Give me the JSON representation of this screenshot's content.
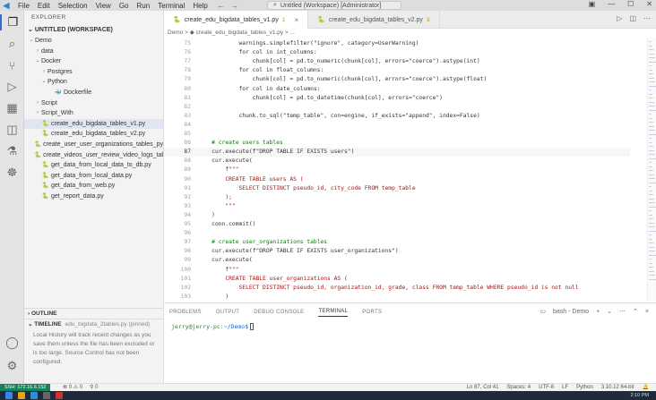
{
  "titlebar": {
    "logo": "◀",
    "menu": [
      "File",
      "Edit",
      "Selection",
      "View",
      "Go",
      "Run",
      "Terminal",
      "Help"
    ],
    "search": "Untitled (Workspace) [Administrator]"
  },
  "activity": [
    {
      "icon": "files-icon",
      "glyph": "❐"
    },
    {
      "icon": "search-icon",
      "glyph": "⌕"
    },
    {
      "icon": "source-control-icon",
      "glyph": "⑂"
    },
    {
      "icon": "run-debug-icon",
      "glyph": "▷"
    },
    {
      "icon": "extensions-icon",
      "glyph": "▦"
    },
    {
      "icon": "remote-explorer-icon",
      "glyph": "◫"
    },
    {
      "icon": "testing-icon",
      "glyph": "⚗"
    },
    {
      "icon": "docker-icon",
      "glyph": "☸"
    }
  ],
  "sidebar": {
    "header": "EXPLORER",
    "workspace": "UNTITLED (WORKSPACE)",
    "items": [
      {
        "label": "Demo",
        "chev": "⌄",
        "icon": "",
        "indent": 0
      },
      {
        "label": "data",
        "chev": "›",
        "icon": "",
        "indent": 1
      },
      {
        "label": "Docker",
        "chev": "⌄",
        "icon": "",
        "indent": 1
      },
      {
        "label": "Postgres",
        "chev": "›",
        "icon": "",
        "indent": 2
      },
      {
        "label": "Python",
        "chev": "⌄",
        "icon": "",
        "indent": 2
      },
      {
        "label": "Dockerfile",
        "chev": "",
        "icon": "🐳",
        "indent": 3
      },
      {
        "label": "Script",
        "chev": "›",
        "icon": "",
        "indent": 1
      },
      {
        "label": "Script_With",
        "chev": "›",
        "icon": "",
        "indent": 1
      },
      {
        "label": "create_edu_bigdata_tables_v1.py",
        "chev": "",
        "icon": "🐍",
        "indent": 1,
        "selected": true
      },
      {
        "label": "create_edu_bigdata_tables_v2.py",
        "chev": "",
        "icon": "🐍",
        "indent": 1
      },
      {
        "label": "create_user_user_organizations_tables_py...",
        "chev": "",
        "icon": "🐍",
        "indent": 1
      },
      {
        "label": "create_videos_user_review_video_logs_tab...",
        "chev": "",
        "icon": "🐍",
        "indent": 1
      },
      {
        "label": "get_data_from_local_data_to_db.py",
        "chev": "",
        "icon": "🐍",
        "indent": 1
      },
      {
        "label": "get_data_from_local_data.py",
        "chev": "",
        "icon": "🐍",
        "indent": 1
      },
      {
        "label": "get_data_from_web.py",
        "chev": "",
        "icon": "🐍",
        "indent": 1
      },
      {
        "label": "get_report_data.py",
        "chev": "",
        "icon": "🐍",
        "indent": 1
      }
    ],
    "outline": "OUTLINE",
    "timeline": "TIMELINE",
    "timeline_file": "edu_bigdata_2tables.py  (pinned)",
    "timeline_msg": "Local History will track recent changes as you save them unless the file has been excluded or is too large. Source Control has not been configured."
  },
  "tabs": [
    {
      "label": "create_edu_bigdata_tables_v1.py",
      "num": "1",
      "active": true
    },
    {
      "label": "create_edu_bigdata_tables_v2.py",
      "num": "3",
      "active": false
    }
  ],
  "breadcrumb": "Demo  >  ◆ create_edu_bigdata_tables_v1.py  >  ...",
  "code": [
    {
      "n": "75",
      "t": "            warnings.simplefilter(\"ignore\", category=UserWarning)"
    },
    {
      "n": "76",
      "t": "            for col in int_columns:"
    },
    {
      "n": "77",
      "t": "                chunk[col] = pd.to_numeric(chunk[col], errors=\"coerce\").astype(int)"
    },
    {
      "n": "78",
      "t": "            for col in float_columns:"
    },
    {
      "n": "79",
      "t": "                chunk[col] = pd.to_numeric(chunk[col], errors=\"coerce\").astype(float)"
    },
    {
      "n": "80",
      "t": "            for col in date_columns:"
    },
    {
      "n": "81",
      "t": "                chunk[col] = pd.to_datetime(chunk[col], errors=\"coerce\")"
    },
    {
      "n": "82",
      "t": ""
    },
    {
      "n": "83",
      "t": "            chunk.to_sql(\"temp_table\", con=engine, if_exists=\"append\", index=False)"
    },
    {
      "n": "84",
      "t": ""
    },
    {
      "n": "85",
      "t": ""
    },
    {
      "n": "86",
      "t": "    # create users tables"
    },
    {
      "n": "87",
      "t": "    cur.execute(f\"DROP TABLE IF EXISTS users\")"
    },
    {
      "n": "88",
      "t": "    cur.execute("
    },
    {
      "n": "89",
      "t": "        f\"\"\""
    },
    {
      "n": "90",
      "t": "        CREATE TABLE users AS ("
    },
    {
      "n": "91",
      "t": "            SELECT DISTINCT pseudo_id, city_code FROM temp_table"
    },
    {
      "n": "92",
      "t": "        );"
    },
    {
      "n": "93",
      "t": "        \"\"\""
    },
    {
      "n": "94",
      "t": "    )"
    },
    {
      "n": "95",
      "t": "    conn.commit()"
    },
    {
      "n": "96",
      "t": ""
    },
    {
      "n": "97",
      "t": "    # create user_organizations tables"
    },
    {
      "n": "98",
      "t": "    cur.execute(f\"DROP TABLE IF EXISTS user_organizations\")"
    },
    {
      "n": "99",
      "t": "    cur.execute("
    },
    {
      "n": "100",
      "t": "        f\"\"\""
    },
    {
      "n": "101",
      "t": "        CREATE TABLE user_organizations AS ("
    },
    {
      "n": "102",
      "t": "            SELECT DISTINCT pseudo_id, organization_id, grade, class FROM temp_table WHERE pseudo_id is not null"
    },
    {
      "n": "103",
      "t": "        )"
    },
    {
      "n": "104",
      "t": "        \"\"\""
    }
  ],
  "panel": {
    "tabs": [
      "PROBLEMS",
      "OUTPUT",
      "DEBUG CONSOLE",
      "TERMINAL",
      "PORTS"
    ],
    "active_tab": "TERMINAL",
    "shell": "bash - Demo",
    "prompt_user": "jerry@jerry-pc",
    "prompt_path": ":~/Demo$"
  },
  "statusbar": {
    "remote": "SSH: 172.16.6.152",
    "problems": "⊗ 0  ⚠ 0",
    "ports": "⚲ 0",
    "position": "Ln 87, Col 41",
    "spaces": "Spaces: 4",
    "encoding": "UTF-8",
    "eol": "LF",
    "lang": "Python",
    "interpreter": "3.10.12 64-bit",
    "time": "2:10 PM"
  }
}
